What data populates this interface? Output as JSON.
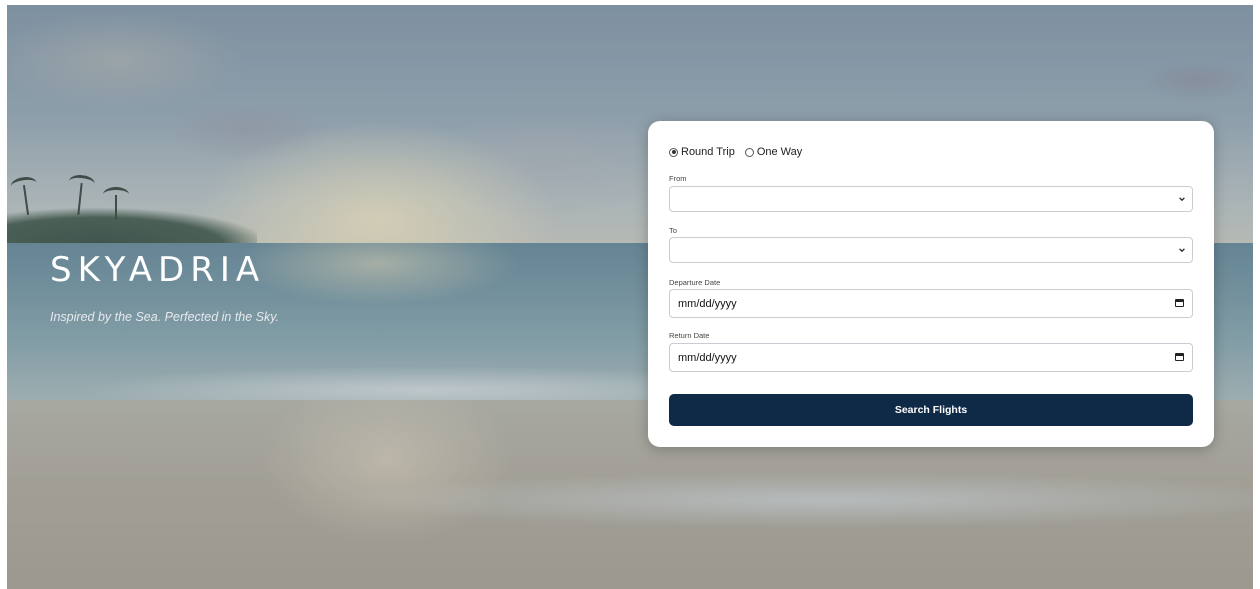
{
  "brand": {
    "name": "SKYADRIA",
    "tagline": "Inspired by the Sea. Perfected in the Sky."
  },
  "trip_type": {
    "options": [
      {
        "label": "Round Trip",
        "selected": true
      },
      {
        "label": "One Way",
        "selected": false
      }
    ]
  },
  "form": {
    "from_label": "From",
    "from_value": "",
    "to_label": "To",
    "to_value": "",
    "departure_label": "Departure Date",
    "departure_value": "mm/dd/yyyy",
    "return_label": "Return Date",
    "return_value": "mm/dd/yyyy",
    "search_label": "Search Flights"
  },
  "icons": {
    "select_arrow": "chevron-down-icon",
    "date_picker": "calendar-icon"
  },
  "colors": {
    "button_bg": "#0f2a47",
    "card_bg": "#ffffff",
    "brand_text": "#ffffff"
  }
}
